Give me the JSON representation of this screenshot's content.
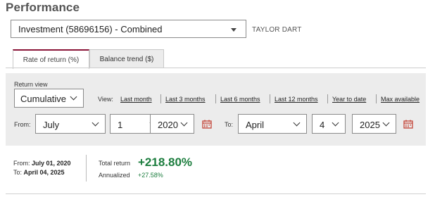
{
  "page": {
    "title": "Performance"
  },
  "account": {
    "selected": "Investment (58696156) - Combined",
    "owner": "TAYLOR DART"
  },
  "tabs": [
    {
      "label": "Rate of return (%)",
      "active": true
    },
    {
      "label": "Balance trend ($)",
      "active": false
    }
  ],
  "filters": {
    "return_view_label": "Return view",
    "return_view_value": "Cumulative",
    "view_label": "View:",
    "view_links": [
      "Last month",
      "Last 3 months",
      "Last 6 months",
      "Last 12 months",
      "Year to date",
      "Max available"
    ],
    "from_label": "From:",
    "to_label": "To:",
    "from": {
      "month": "July",
      "day": "1",
      "year": "2020"
    },
    "to": {
      "month": "April",
      "day": "4",
      "year": "2025"
    }
  },
  "summary": {
    "from_prefix": "From:",
    "from_date": "July 01, 2020",
    "to_prefix": "To:",
    "to_date": "April 04, 2025",
    "total_return_label": "Total return",
    "total_return_value": "+218.80%",
    "annualized_label": "Annualized",
    "annualized_value": "+27.58%"
  },
  "colors": {
    "accent": "#8a1538",
    "positive": "#1c7d3e",
    "calendar_icon": "#c0392b",
    "panel_bg": "#ececec"
  },
  "icons": {
    "calendar": "calendar-icon",
    "dropdown": "chevron-down-icon"
  }
}
